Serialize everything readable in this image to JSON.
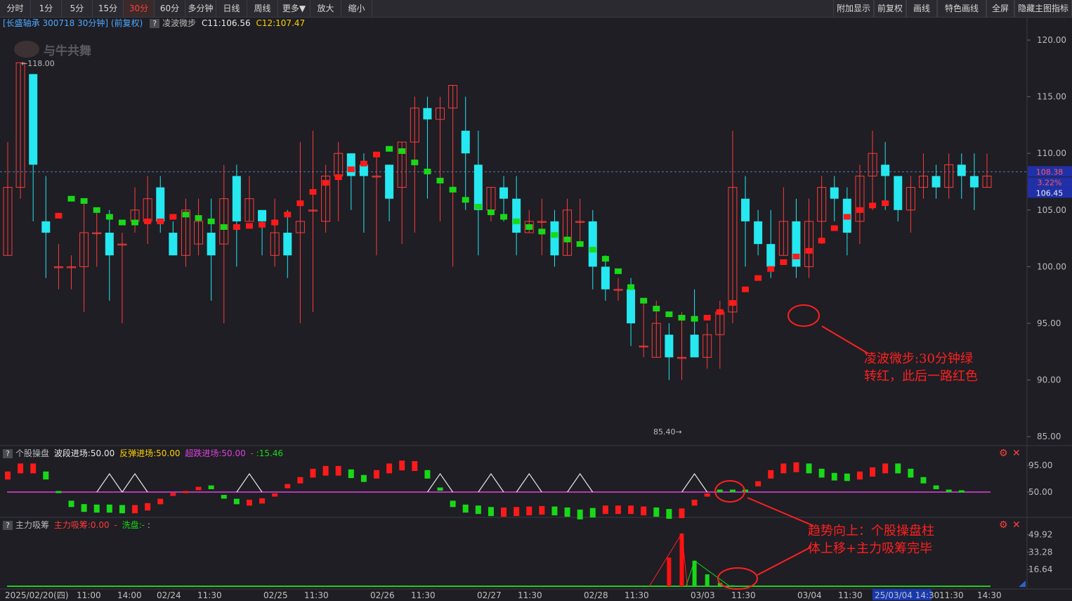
{
  "toolbar": {
    "left": [
      "分时",
      "1分",
      "5分",
      "15分",
      "30分",
      "60分",
      "多分钟",
      "日线",
      "周线",
      "更多▼",
      "放大",
      "缩小"
    ],
    "active": "30分",
    "right": [
      "附加显示",
      "前复权",
      "画线",
      "特色画线",
      "全屏",
      "隐藏主图指标"
    ]
  },
  "main_header": {
    "title": "[长盛轴承 300718 30分钟]",
    "adj": "(前复权)",
    "indicator": "凌波微步",
    "c11": "C11:106.56",
    "c12": "C12:107.47",
    "help": "?"
  },
  "watermark": "与牛共舞",
  "ind1_header": {
    "help": "?",
    "name": "个股操盘",
    "v1": "波段进场:50.00",
    "v2": "反弹进场:50.00",
    "v3": "超跌进场:50.00",
    "v4": "-",
    "v5": ":15.46"
  },
  "ind2_header": {
    "help": "?",
    "name": "主力吸筹",
    "v1": "主力吸筹:0.00",
    "v2": "-",
    "v3": "洗盘:-",
    "v4": ":"
  },
  "x_axis_labels": [
    "2025/02/20(四)",
    "11:00",
    "14:00",
    "02/24",
    "11:30",
    "02/25",
    "11:30",
    "02/26",
    "11:30",
    "02/27",
    "11:30",
    "02/28",
    "11:30",
    "03/03",
    "11:30",
    "03/04",
    "11:30",
    "25/03/04 14:30",
    "11:30",
    "14:30"
  ],
  "annotations": {
    "a1_line1": "凌波微步:30分钟绿",
    "a1_line2": "转红，此后一路红色",
    "a2_line1": "趋势向上：个股操盘柱",
    "a2_line2": "体上移+主力吸筹完毕"
  },
  "price_tags": {
    "high_label": "118.00",
    "low_label": "85.40",
    "tag_top": "108.38",
    "tag_pct": "3.22%",
    "tag_bottom": "106.45"
  },
  "colors": {
    "up": "#ff3b3b",
    "down": "#25e8f0",
    "dot_red": "#ff1a1a",
    "dot_green": "#18d818",
    "magenta": "#e040e0",
    "annotation": "#ff2020",
    "background": "#1e1e24"
  },
  "chart_data": [
    {
      "type": "candlestick",
      "title": "长盛轴承 300718 30分钟",
      "ylim": [
        84,
        122
      ],
      "y_ticks": [
        120.0,
        115.0,
        110.0,
        105.0,
        100.0,
        95.0,
        90.0,
        85.0
      ],
      "candles": [
        [
          101,
          107,
          101,
          111
        ],
        [
          107,
          118,
          106,
          118
        ],
        [
          117,
          109,
          104,
          117
        ],
        [
          104,
          103,
          99,
          108
        ],
        [
          100,
          100,
          98,
          102
        ],
        [
          100,
          100,
          98,
          101
        ],
        [
          100,
          103,
          96,
          106
        ],
        [
          103,
          103,
          100,
          105
        ],
        [
          103,
          101,
          97,
          105
        ],
        [
          102,
          102,
          95,
          103
        ],
        [
          104,
          105,
          103,
          107
        ],
        [
          104,
          106,
          102,
          108
        ],
        [
          107,
          104,
          103,
          108
        ],
        [
          103,
          101,
          101,
          104
        ],
        [
          101,
          105,
          100,
          106
        ],
        [
          102,
          104,
          101,
          106
        ],
        [
          103,
          101,
          97,
          106
        ],
        [
          102,
          106,
          95,
          109
        ],
        [
          108,
          104,
          100,
          109
        ],
        [
          104,
          106,
          104,
          108
        ],
        [
          105,
          104,
          101,
          105
        ],
        [
          101,
          103,
          100,
          106
        ],
        [
          103,
          101,
          99,
          105
        ],
        [
          103,
          104,
          95,
          111
        ],
        [
          105,
          105,
          96,
          112
        ],
        [
          104,
          108,
          103,
          109
        ],
        [
          108,
          110,
          104,
          111
        ],
        [
          110,
          108,
          105,
          110
        ],
        [
          109,
          108,
          103,
          110
        ],
        [
          108,
          108,
          101,
          110
        ],
        [
          109,
          106,
          104,
          109
        ],
        [
          107,
          111,
          102,
          111
        ],
        [
          111,
          114,
          103,
          115
        ],
        [
          114,
          113,
          106,
          115
        ],
        [
          113,
          114,
          104,
          115
        ],
        [
          114,
          116,
          100,
          116
        ],
        [
          112,
          110,
          105,
          115
        ],
        [
          109,
          105,
          101,
          112
        ],
        [
          105,
          107,
          104,
          107
        ],
        [
          107,
          106,
          104,
          108
        ],
        [
          106,
          103,
          101,
          108
        ],
        [
          103,
          104,
          103,
          105
        ],
        [
          104,
          104,
          101,
          106
        ],
        [
          104,
          101,
          100,
          105
        ],
        [
          101,
          105,
          101,
          106
        ],
        [
          104,
          104,
          102,
          106
        ],
        [
          104,
          100,
          98,
          105
        ],
        [
          100,
          98,
          97,
          101
        ],
        [
          98,
          98,
          97,
          99
        ],
        [
          98,
          95,
          93,
          99
        ],
        [
          93,
          93,
          92,
          97
        ],
        [
          92,
          95,
          92,
          97
        ],
        [
          94,
          92,
          90,
          95
        ],
        [
          92,
          92,
          90,
          96
        ],
        [
          94,
          92,
          92,
          98
        ],
        [
          92,
          94,
          91,
          95
        ],
        [
          94,
          96,
          91,
          97
        ],
        [
          96,
          107,
          95,
          112
        ],
        [
          106,
          104,
          100,
          108
        ],
        [
          104,
          102,
          101,
          105
        ],
        [
          102,
          100,
          99,
          105
        ],
        [
          101,
          104,
          101,
          107
        ],
        [
          104,
          100,
          99,
          106
        ],
        [
          100,
          104,
          99,
          106
        ],
        [
          104,
          107,
          102,
          108
        ],
        [
          107,
          106,
          104,
          108
        ],
        [
          106,
          103,
          101,
          107
        ],
        [
          104,
          108,
          102,
          109
        ],
        [
          108,
          110,
          105,
          112
        ],
        [
          109,
          108,
          105,
          111
        ],
        [
          108,
          105,
          104,
          108
        ],
        [
          105,
          107,
          103,
          108
        ],
        [
          107,
          108,
          106,
          110
        ],
        [
          108,
          107,
          106,
          109
        ],
        [
          107,
          109,
          106,
          110
        ],
        [
          109,
          108,
          106,
          110
        ],
        [
          108,
          107,
          105,
          110
        ],
        [
          107,
          108,
          107,
          110
        ]
      ],
      "low_marker": 85.4,
      "high_marker": 118.0,
      "current_price": 108.38
    },
    {
      "type": "indicator",
      "name": "个股操盘",
      "y_ticks": [
        95.0,
        50.0
      ]
    },
    {
      "type": "bar",
      "name": "主力吸筹",
      "y_ticks": [
        49.92,
        33.28,
        16.64
      ]
    }
  ]
}
